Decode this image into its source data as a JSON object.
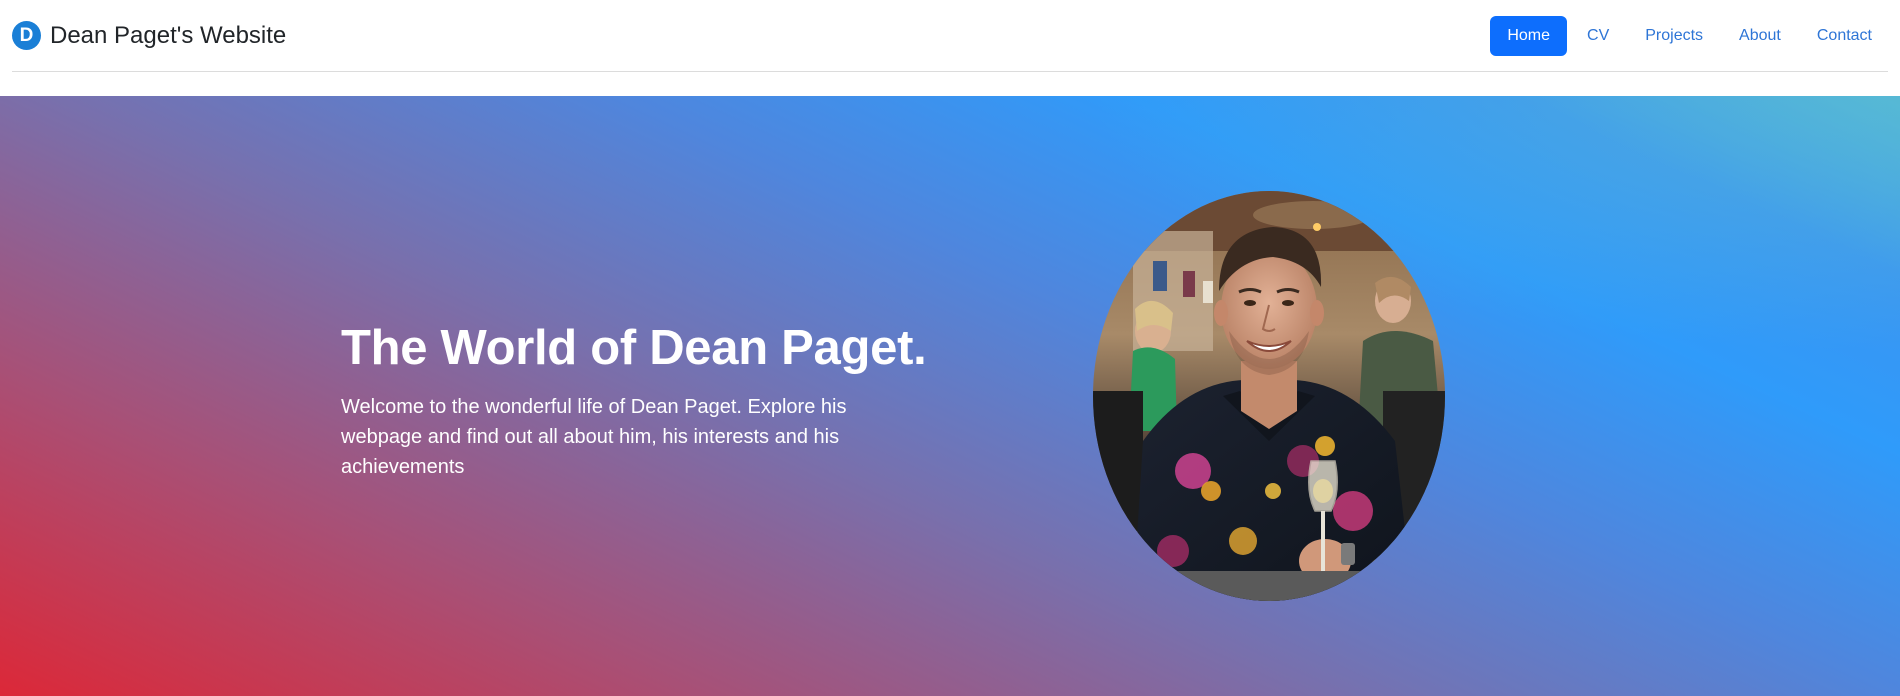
{
  "brand": {
    "logo_letter": "D",
    "name": "Dean Paget's Website",
    "logo_color": "#1a7fd6"
  },
  "nav": {
    "items": [
      {
        "label": "Home",
        "active": true
      },
      {
        "label": "CV",
        "active": false
      },
      {
        "label": "Projects",
        "active": false
      },
      {
        "label": "About",
        "active": false
      },
      {
        "label": "Contact",
        "active": false
      }
    ],
    "active_color": "#0d6efd",
    "link_color": "#2e75d6"
  },
  "hero": {
    "title": "The World of Dean Paget.",
    "subtitle": "Welcome to the wonderful life of Dean Paget. Explore his webpage and find out all about him, his interests and his achievements",
    "gradient_colors": [
      "#dc2838",
      "#a85076",
      "#7870ad",
      "#2f9bfa",
      "#52b3d8"
    ]
  },
  "portrait": {
    "icon": "profile-photo"
  }
}
